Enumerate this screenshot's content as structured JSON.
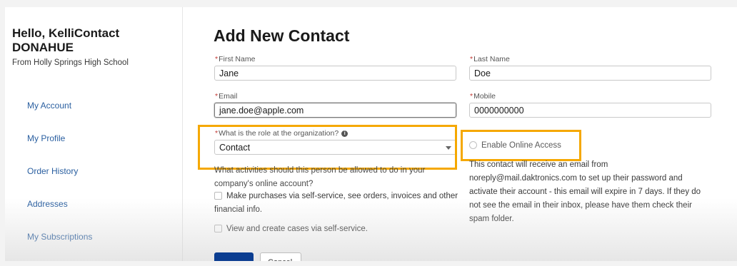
{
  "sidebar": {
    "greeting_line1": "Hello, KelliContact",
    "greeting_line2": "DONAHUE",
    "school": "From Holly Springs High School",
    "items": [
      {
        "label": "My Account"
      },
      {
        "label": "My Profile"
      },
      {
        "label": "Order History"
      },
      {
        "label": "Addresses"
      },
      {
        "label": "My Subscriptions"
      }
    ]
  },
  "form": {
    "title": "Add New Contact",
    "required_mark": "*",
    "first_name": {
      "label": "First Name",
      "value": "Jane"
    },
    "last_name": {
      "label": "Last Name",
      "value": "Doe"
    },
    "email": {
      "label": "Email",
      "value": "jane.doe@apple.com"
    },
    "mobile": {
      "label": "Mobile",
      "value": "0000000000"
    },
    "role": {
      "label": "What is the role at the organization?",
      "info_icon": "i",
      "value": "Contact"
    },
    "activities_question_line1": "What activities should this person be allowed to do in your",
    "activities_question_line2": "company's online account?",
    "option_purchases_line1": "Make purchases via self-service, see orders, invoices and other",
    "option_purchases_line2": "financial info.",
    "option_cases": "View and create cases via self-service.",
    "enable_online_access": "Enable Online Access",
    "notice_lines": [
      "This contact will receive an email from",
      "noreply@mail.daktronics.com to set up their password and",
      "activate their account - this email will expire in 7 days. If they do",
      "not see the email in their inbox, please have them check their",
      "spam folder."
    ],
    "cancel_label": "Cancel"
  },
  "colors": {
    "highlight": "#f5a800",
    "primary_button": "#0b3d91",
    "link": "#2a5fa0"
  }
}
